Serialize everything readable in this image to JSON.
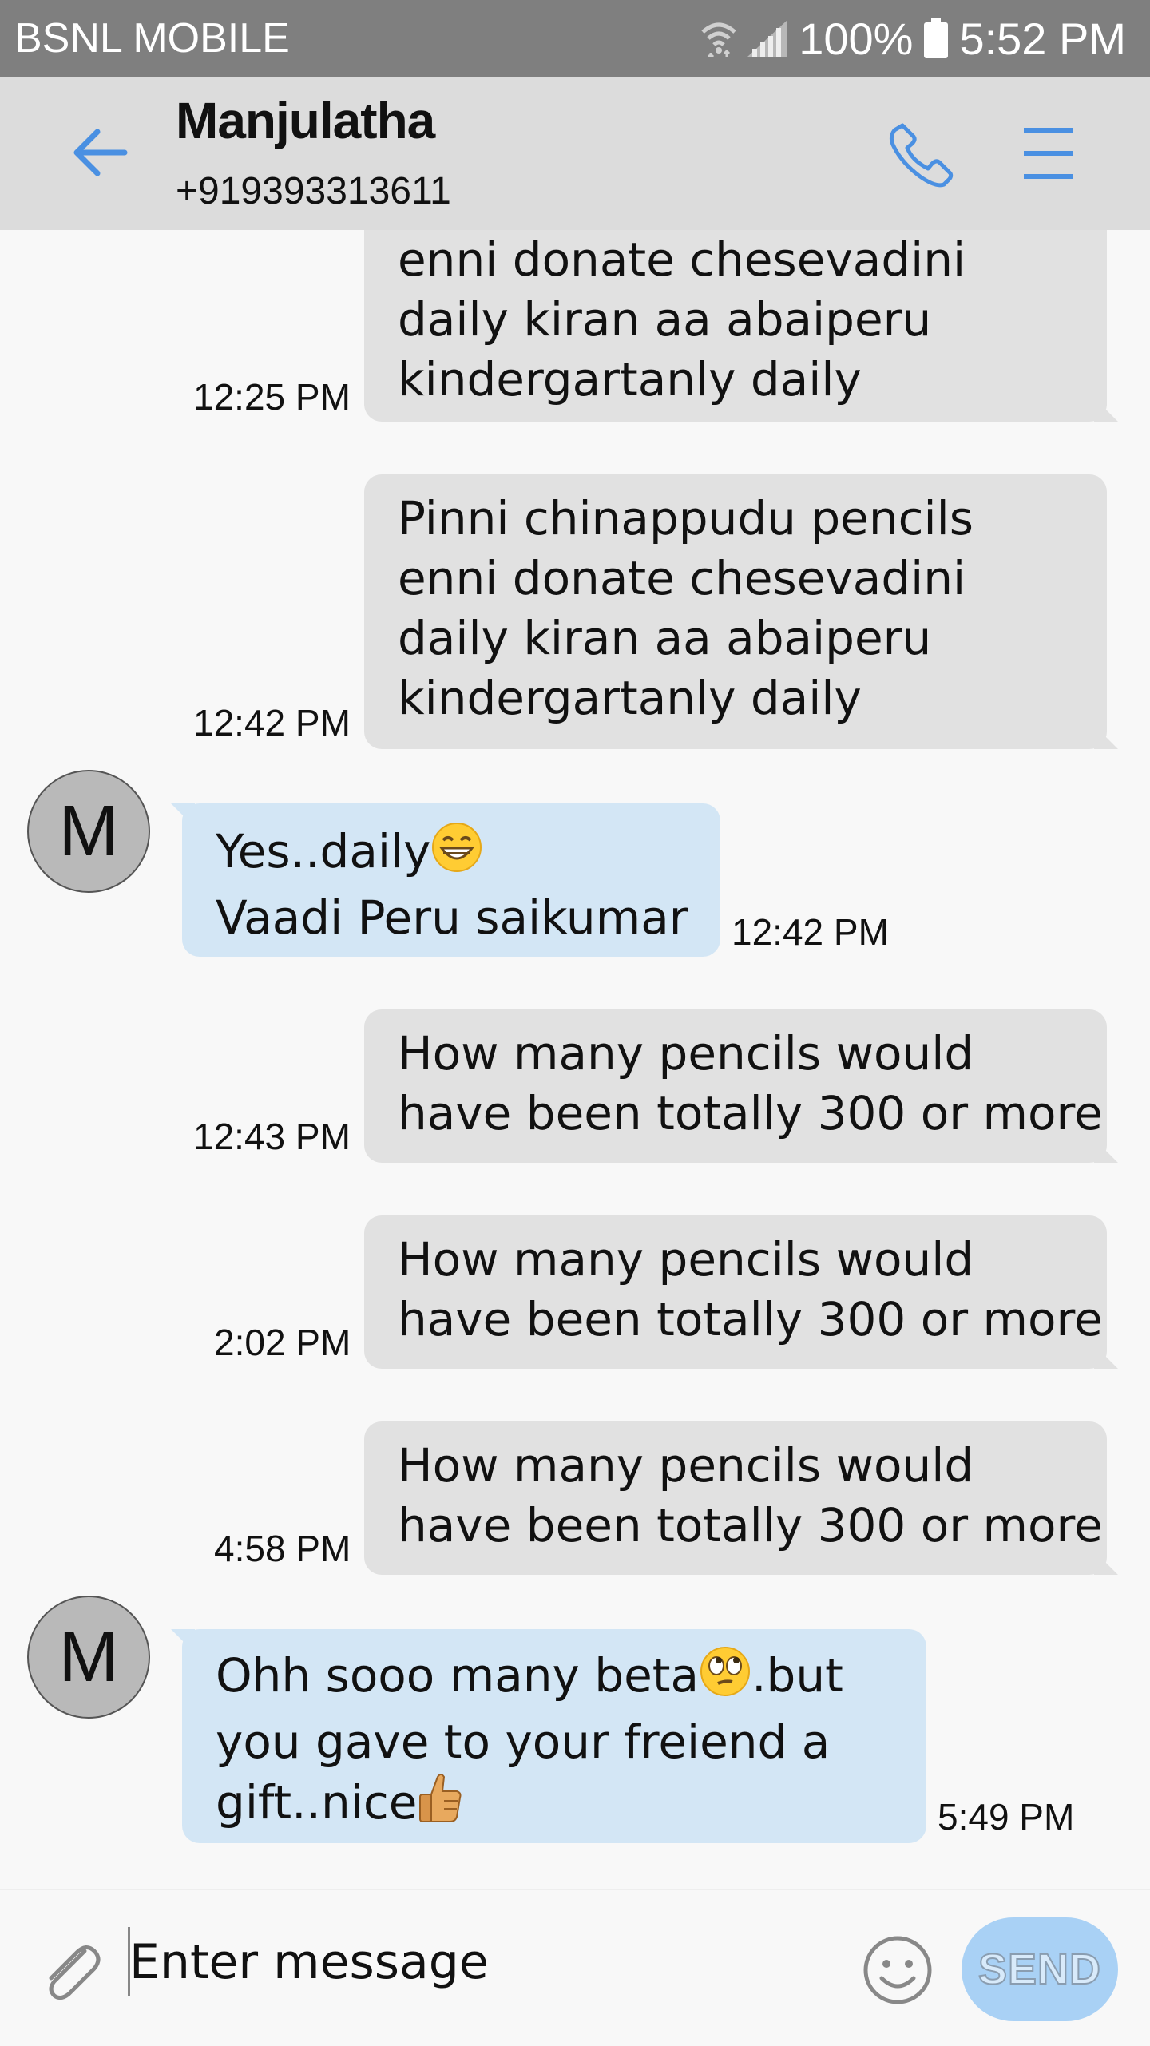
{
  "status_bar": {
    "carrier": "BSNL MOBILE",
    "battery": "100%",
    "time": "5:52 PM",
    "icons": [
      "wifi-icon",
      "signal-icon",
      "battery-icon"
    ]
  },
  "header": {
    "contact_name": "Manjulatha",
    "contact_number": "+919393313611",
    "icons": [
      "back-arrow-icon",
      "phone-icon",
      "menu-icon"
    ],
    "accent_color": "#4a90e2"
  },
  "messages": [
    {
      "direction": "outgoing",
      "lines": [
        "enni donate chesevadini",
        "daily kiran aa abaiperu",
        "kindergartanly daily"
      ],
      "time": "12:25 PM"
    },
    {
      "direction": "outgoing",
      "lines": [
        "Pinni chinappudu pencils",
        "enni donate chesevadini",
        "daily kiran aa abaiperu",
        "kindergartanly daily"
      ],
      "time": "12:42 PM"
    },
    {
      "direction": "incoming",
      "avatar_letter": "M",
      "lines": [
        "Yes..daily",
        "Vaadi Peru saikumar"
      ],
      "time": "12:42 PM"
    },
    {
      "direction": "outgoing",
      "lines": [
        "How many pencils would",
        "have been totally 300 or more"
      ],
      "time": "12:43 PM"
    },
    {
      "direction": "outgoing",
      "lines": [
        "How many pencils would",
        "have been totally 300 or more"
      ],
      "time": "2:02 PM"
    },
    {
      "direction": "outgoing",
      "lines": [
        "How many pencils would",
        "have been totally 300 or more"
      ],
      "time": "4:58 PM"
    },
    {
      "direction": "incoming",
      "avatar_letter": "M",
      "lines": [
        "Ohh sooo many beta",
        ".but",
        "you gave to your freiend a",
        "gift..nice"
      ],
      "time": "5:49 PM"
    }
  ],
  "composer": {
    "placeholder": "Enter message",
    "send_label": "SEND",
    "icons": [
      "paperclip-icon",
      "smiley-icon"
    ]
  },
  "colors": {
    "outgoing_bubble": "#e1e1e1",
    "incoming_bubble": "#d3e6f5",
    "status_bar": "#7f7f7f",
    "header": "#dcdcdc",
    "send_button": "#a9d1f5"
  }
}
